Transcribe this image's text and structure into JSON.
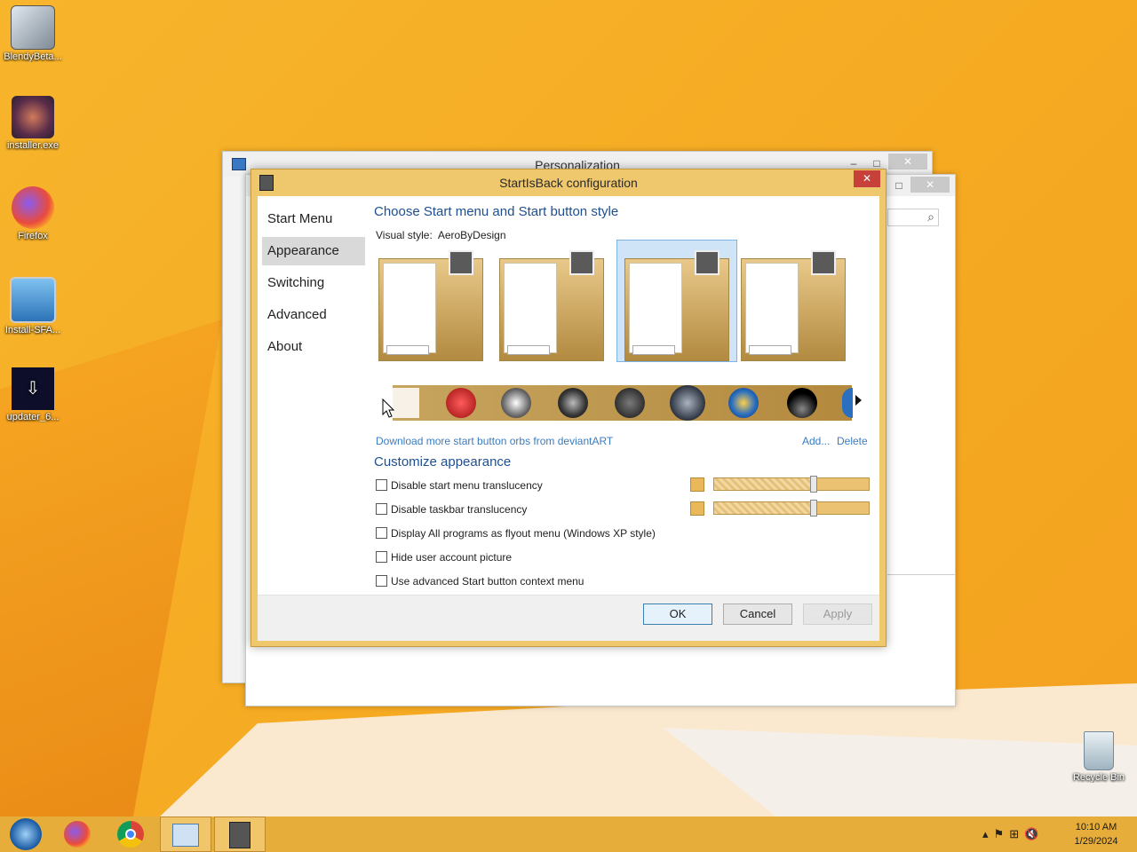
{
  "desktop": {
    "icons": [
      {
        "label": "BlendyBeta..."
      },
      {
        "label": "installer.exe"
      },
      {
        "label": "Firefox"
      },
      {
        "label": "Install-SFA..."
      },
      {
        "label": "updater_6..."
      },
      {
        "label": "Recycle Bin"
      }
    ]
  },
  "background_windows": {
    "personalization_title": "Personalization",
    "minimize": "–",
    "maximize": "□",
    "close": "✕",
    "search_icon": "⌕"
  },
  "dialog": {
    "title": "StartIsBack configuration",
    "close": "✕",
    "nav": [
      "Start Menu",
      "Appearance",
      "Switching",
      "Advanced",
      "About"
    ],
    "selected_nav": "Appearance",
    "heading": "Choose Start menu and Start button style",
    "visual_style_label": "Visual style:",
    "visual_style_value": "AeroByDesign",
    "download_link": "Download more start button orbs from deviantART",
    "add_link": "Add...",
    "delete_link": "Delete",
    "customize_heading": "Customize appearance",
    "options": [
      {
        "label": "Disable start menu translucency",
        "checked": false
      },
      {
        "label": "Disable taskbar translucency",
        "checked": false
      },
      {
        "label": "Display All programs as flyout menu (Windows XP style)",
        "checked": false
      },
      {
        "label": "Hide user account picture",
        "checked": false
      },
      {
        "label": "Use advanced Start button context menu",
        "checked": false
      }
    ],
    "slider_levels": [
      0.65,
      0.65
    ],
    "swatch_color": "#e8b85b",
    "buttons": {
      "ok": "OK",
      "cancel": "Cancel",
      "apply": "Apply"
    }
  },
  "taskbar": {
    "time": "10:10 AM",
    "date": "1/29/2024"
  },
  "colors": {
    "desktop": "#f5aa22",
    "dialog_frame": "#efc76d",
    "taskbar": "#e6ad3a",
    "accent_text": "#1d4f91",
    "link": "#3a7cc2"
  }
}
